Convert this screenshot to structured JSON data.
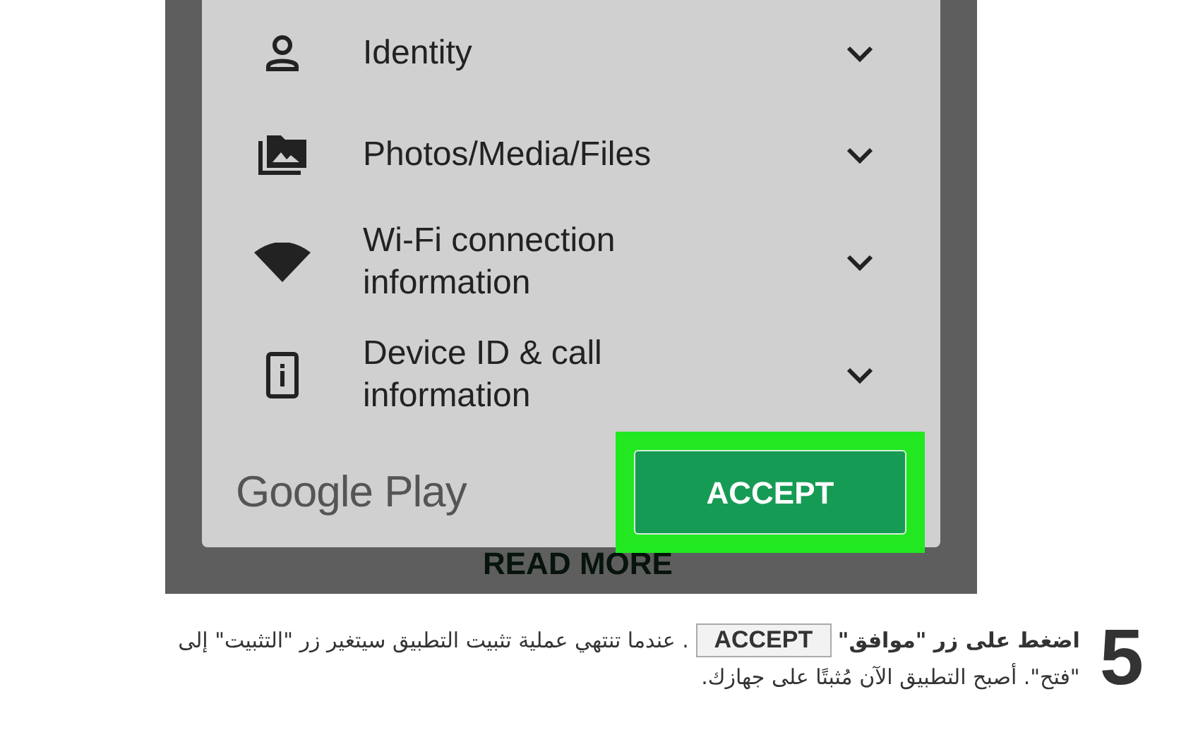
{
  "permissions": [
    {
      "kind": "person",
      "label": "Identity"
    },
    {
      "kind": "photos",
      "label": "Photos/Media/Files"
    },
    {
      "kind": "wifi",
      "label": "Wi-Fi connection information"
    },
    {
      "kind": "device",
      "label": "Device ID & call information"
    }
  ],
  "store_name": "Google Play",
  "accept_button": "ACCEPT",
  "read_more": "READ MORE",
  "step": {
    "number": "5",
    "lead": "**اضغط على زر \"موافق\"**",
    "key": "ACCEPT",
    "rest": ". عندما تنتهي عملية تثبيت التطبيق سيتغير زر \"التثبيت\" إلى \"فتح\". أصبح التطبيق الآن مُثبتًا على جهازك."
  }
}
